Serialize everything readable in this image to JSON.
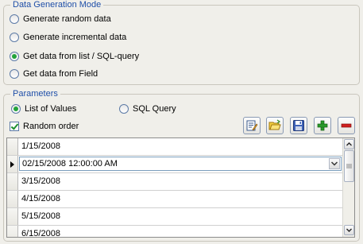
{
  "mode_group": {
    "legend": "Data Generation Mode",
    "options": [
      {
        "label": "Generate random data",
        "selected": false
      },
      {
        "label": "Generate incremental data",
        "selected": false
      },
      {
        "label": "Get data from list / SQL-query",
        "selected": true
      },
      {
        "label": "Get data from Field",
        "selected": false
      }
    ]
  },
  "params_group": {
    "legend": "Parameters",
    "source_options": [
      {
        "label": "List of Values",
        "selected": true
      },
      {
        "label": "SQL Query",
        "selected": false
      }
    ],
    "random_order": {
      "label": "Random order",
      "checked": true
    },
    "toolbar": [
      "edit-icon",
      "open-folder-icon",
      "save-icon",
      "add-icon",
      "remove-icon"
    ]
  },
  "values_grid": {
    "rows": [
      "1/15/2008",
      "02/15/2008 12:00:00 AM",
      "3/15/2008",
      "4/15/2008",
      "5/15/2008",
      "6/15/2008"
    ],
    "current_row_index": 1
  },
  "colors": {
    "legend_text": "#1f4fa8",
    "radio_selected": "#22a33a",
    "add_button": "#2a9a2a",
    "remove_button": "#d02020"
  }
}
